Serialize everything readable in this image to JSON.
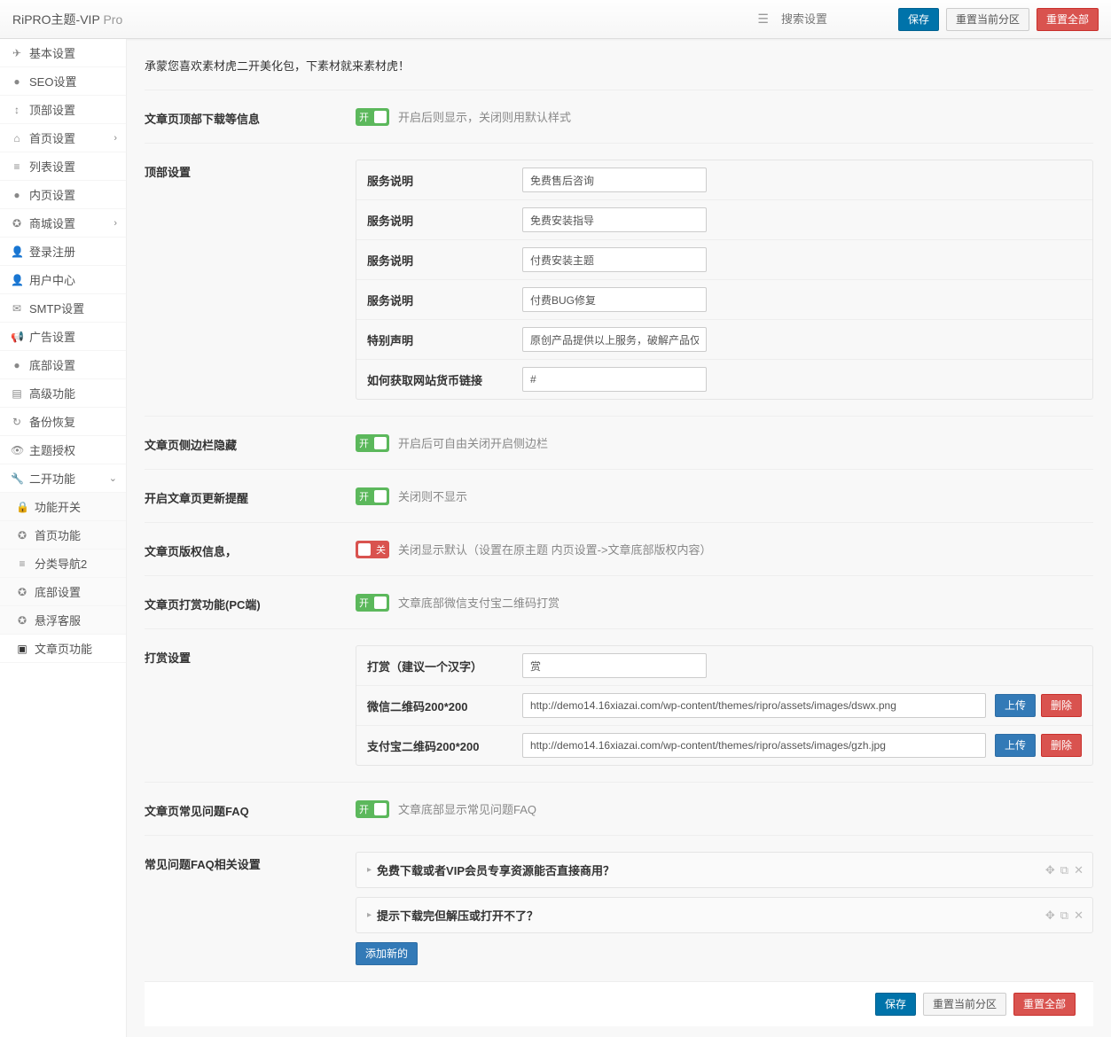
{
  "topbar": {
    "title": "RiPRO主题-VIP",
    "title_suffix": "Pro",
    "search_placeholder": "搜索设置",
    "save": "保存",
    "reset_section": "重置当前分区",
    "reset_all": "重置全部"
  },
  "sidebar": {
    "items": [
      {
        "icon": "✈",
        "label": "基本设置"
      },
      {
        "icon": "●",
        "label": "SEO设置"
      },
      {
        "icon": "↕",
        "label": "顶部设置"
      },
      {
        "icon": "⌂",
        "label": "首页设置",
        "chev": true
      },
      {
        "icon": "≡",
        "label": "列表设置"
      },
      {
        "icon": "●",
        "label": "内页设置"
      },
      {
        "icon": "✪",
        "label": "商城设置",
        "chev": true
      },
      {
        "icon": "👤",
        "label": "登录注册"
      },
      {
        "icon": "👤",
        "label": "用户中心"
      },
      {
        "icon": "✉",
        "label": "SMTP设置"
      },
      {
        "icon": "📢",
        "label": "广告设置"
      },
      {
        "icon": "●",
        "label": "底部设置"
      },
      {
        "icon": "▤",
        "label": "高级功能"
      },
      {
        "icon": "↻",
        "label": "备份恢复"
      },
      {
        "icon": "👁",
        "label": "主题授权"
      },
      {
        "icon": "🔧",
        "label": "二开功能",
        "chev_down": true
      }
    ],
    "sub": [
      {
        "icon": "🔒",
        "label": "功能开关"
      },
      {
        "icon": "✪",
        "label": "首页功能"
      },
      {
        "icon": "≡",
        "label": "分类导航2"
      },
      {
        "icon": "✪",
        "label": "底部设置"
      },
      {
        "icon": "✪",
        "label": "悬浮客服"
      },
      {
        "icon": "▣",
        "label": "文章页功能",
        "active": true
      }
    ]
  },
  "intro": "承蒙您喜欢素材虎二开美化包，下素材就来素材虎！",
  "sections": {
    "top_info": {
      "label": "文章页顶部下载等信息",
      "switch": "on",
      "on_text": "开",
      "hint": "开启后则显示，关闭则用默认样式"
    },
    "top_settings": {
      "label": "顶部设置",
      "rows": [
        {
          "label": "服务说明",
          "value": "免费售后咨询"
        },
        {
          "label": "服务说明",
          "value": "免费安装指导"
        },
        {
          "label": "服务说明",
          "value": "付费安装主题"
        },
        {
          "label": "服务说明",
          "value": "付费BUG修复"
        },
        {
          "label": "特别声明",
          "value": "原创产品提供以上服务，破解产品仅供参"
        },
        {
          "label": "如何获取网站货币链接",
          "value": "#"
        }
      ]
    },
    "sidebar_hide": {
      "label": "文章页侧边栏隐藏",
      "switch": "on",
      "on_text": "开",
      "hint": "开启后可自由关闭开启侧边栏"
    },
    "update_tip": {
      "label": "开启文章页更新提醒",
      "switch": "on",
      "on_text": "开",
      "hint": "关闭则不显示"
    },
    "copyright": {
      "label": "文章页版权信息，",
      "switch": "off",
      "off_text": "关",
      "hint": "关闭显示默认（设置在原主题 内页设置->文章底部版权内容）"
    },
    "reward_pc": {
      "label": "文章页打赏功能(PC端)",
      "switch": "on",
      "on_text": "开",
      "hint": "文章底部微信支付宝二维码打赏"
    },
    "reward_settings": {
      "label": "打赏设置",
      "reward_label": "打赏（建议一个汉字）",
      "reward_value": "赏",
      "wechat_label": "微信二维码200*200",
      "wechat_value": "http://demo14.16xiazai.com/wp-content/themes/ripro/assets/images/dswx.png",
      "alipay_label": "支付宝二维码200*200",
      "alipay_value": "http://demo14.16xiazai.com/wp-content/themes/ripro/assets/images/gzh.jpg",
      "upload": "上传",
      "delete": "删除"
    },
    "faq_switch": {
      "label": "文章页常见问题FAQ",
      "switch": "on",
      "on_text": "开",
      "hint": "文章底部显示常见问题FAQ"
    },
    "faq_settings": {
      "label": "常见问题FAQ相关设置",
      "items": [
        "免费下载或者VIP会员专享资源能否直接商用？",
        "提示下载完但解压或打开不了？"
      ],
      "add_new": "添加新的"
    }
  },
  "footer": {
    "save": "保存",
    "reset_section": "重置当前分区",
    "reset_all": "重置全部"
  }
}
